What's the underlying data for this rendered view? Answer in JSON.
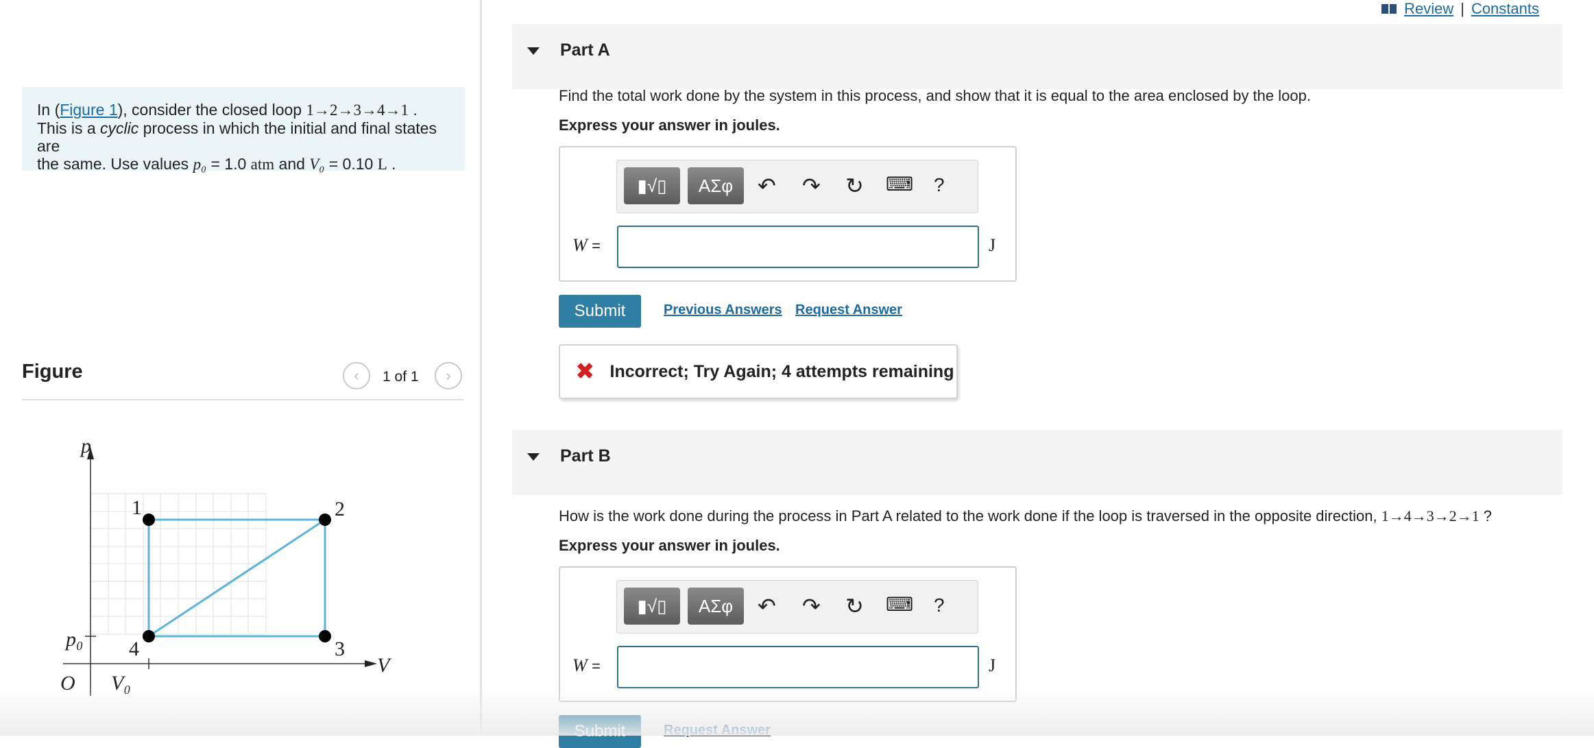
{
  "header_links": {
    "review": "Review",
    "separator": "|",
    "constants": "Constants"
  },
  "intro": {
    "in_prefix": "In (",
    "figure_link": "Figure 1",
    "after_link": "), consider the closed loop ",
    "loop": "1→2→3→4→1",
    "dot1": " .",
    "line2_a": "This is a ",
    "cyclic": "cyclic",
    "line2_b": " process in which the initial and final states are",
    "line3_a": "the same. Use values ",
    "p0_sym": "p₀",
    "p0_val": " = 1.0 ",
    "p0_unit": "atm",
    "and_word": " and ",
    "v0_sym": "V₀",
    "v0_val": " = 0.10 ",
    "v0_unit": "L",
    "end_dot": " ."
  },
  "figure": {
    "title": "Figure",
    "counter": "1 of 1",
    "axis_p": "p",
    "axis_v": "V",
    "origin": "O",
    "p0_label": "p₀",
    "v0_label": "V₀",
    "state_labels": [
      "1",
      "2",
      "3",
      "4"
    ]
  },
  "part_a": {
    "title": "Part A",
    "question": "Find the total work done by the system in this process, and show that it is equal to the area enclosed by the loop.",
    "express": "Express your answer in joules.",
    "toolbar": {
      "templates": "▮√▯",
      "symbols": "ΑΣφ",
      "help": "?"
    },
    "variable": "W",
    "equals": "=",
    "unit": "J",
    "submit": "Submit",
    "previous_answers": "Previous Answers",
    "request_answer": "Request Answer",
    "feedback_icon": "✖",
    "feedback": "Incorrect; Try Again; 4 attempts remaining"
  },
  "part_b": {
    "title": "Part B",
    "question_prefix": "How is the work done during the process in Part A related to the work done if the loop is traversed in the opposite direction, ",
    "question_loop": "1→4→3→2→1",
    "question_suffix": " ?",
    "express": "Express your answer in joules.",
    "toolbar": {
      "templates": "▮√▯",
      "symbols": "ΑΣφ",
      "help": "?"
    },
    "variable": "W",
    "equals": "=",
    "unit": "J",
    "submit": "Submit",
    "request_answer": "Request Answer"
  },
  "icons": [
    "book-icon",
    "collapse-triangle-icon",
    "undo-icon",
    "redo-icon",
    "reset-icon",
    "keyboard-icon",
    "help-icon",
    "incorrect-x-icon",
    "chevron-left-icon",
    "chevron-right-icon"
  ],
  "colors": {
    "accent": "#2f7ea3",
    "link": "#1a6aa3",
    "loop_line": "#5bb4d8",
    "error": "#d21f1f",
    "intro_bg": "#e9f5f6"
  }
}
